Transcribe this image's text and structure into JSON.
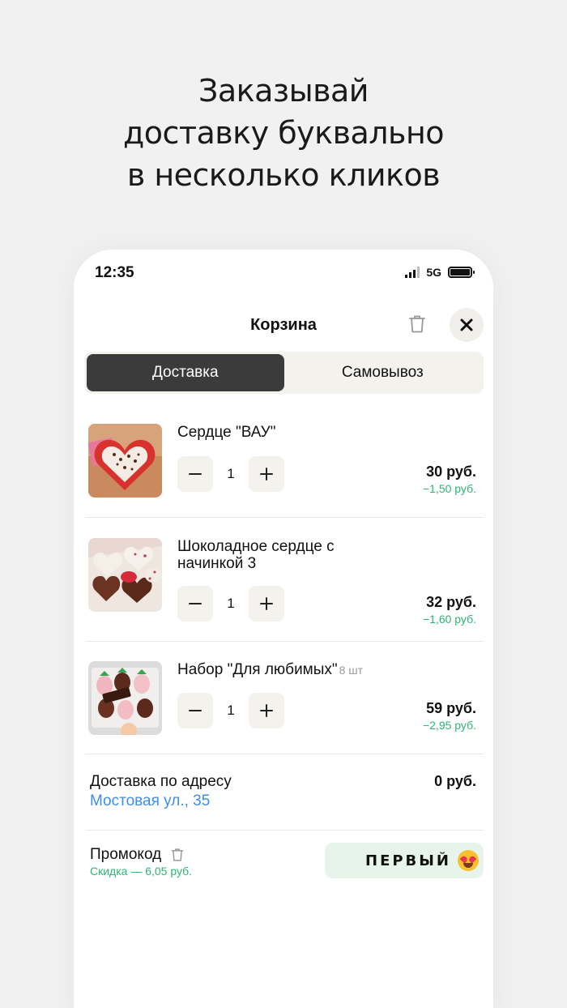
{
  "headline": {
    "line1": "Заказывай",
    "line2": "доставку буквально",
    "line3": "в несколько кликов"
  },
  "status_bar": {
    "time": "12:35",
    "network": "5G"
  },
  "header": {
    "title": "Корзина",
    "trash_icon": "trash-icon",
    "close_icon": "close-icon"
  },
  "tabs": [
    {
      "label": "Доставка",
      "active": true
    },
    {
      "label": "Самовывоз",
      "active": false
    }
  ],
  "items": [
    {
      "name": "Сердце \"ВАУ\"",
      "qty_note": "",
      "quantity": "1",
      "price": "30 руб.",
      "discount": "−1,50 руб."
    },
    {
      "name": "Шоколадное сердце с начинкой 3",
      "qty_note": "",
      "quantity": "1",
      "price": "32 руб.",
      "discount": "−1,60 руб."
    },
    {
      "name": "Набор \"Для любимых\"",
      "qty_note": "8 шт",
      "quantity": "1",
      "price": "59 руб.",
      "discount": "−2,95 руб."
    }
  ],
  "delivery": {
    "label": "Доставка по адресу",
    "address": "Мостовая ул., 35",
    "amount": "0 руб."
  },
  "promo": {
    "label": "Промокод",
    "discount": "Скидка — 6,05 руб.",
    "code": "ПЕРВЫЙ",
    "emoji": "heart-eyes-emoji"
  },
  "colors": {
    "accent_green": "#2bb673",
    "link_blue": "#3d8ef0",
    "active_tab": "#3b3b3b",
    "promo_bg": "#e7f4ec"
  }
}
